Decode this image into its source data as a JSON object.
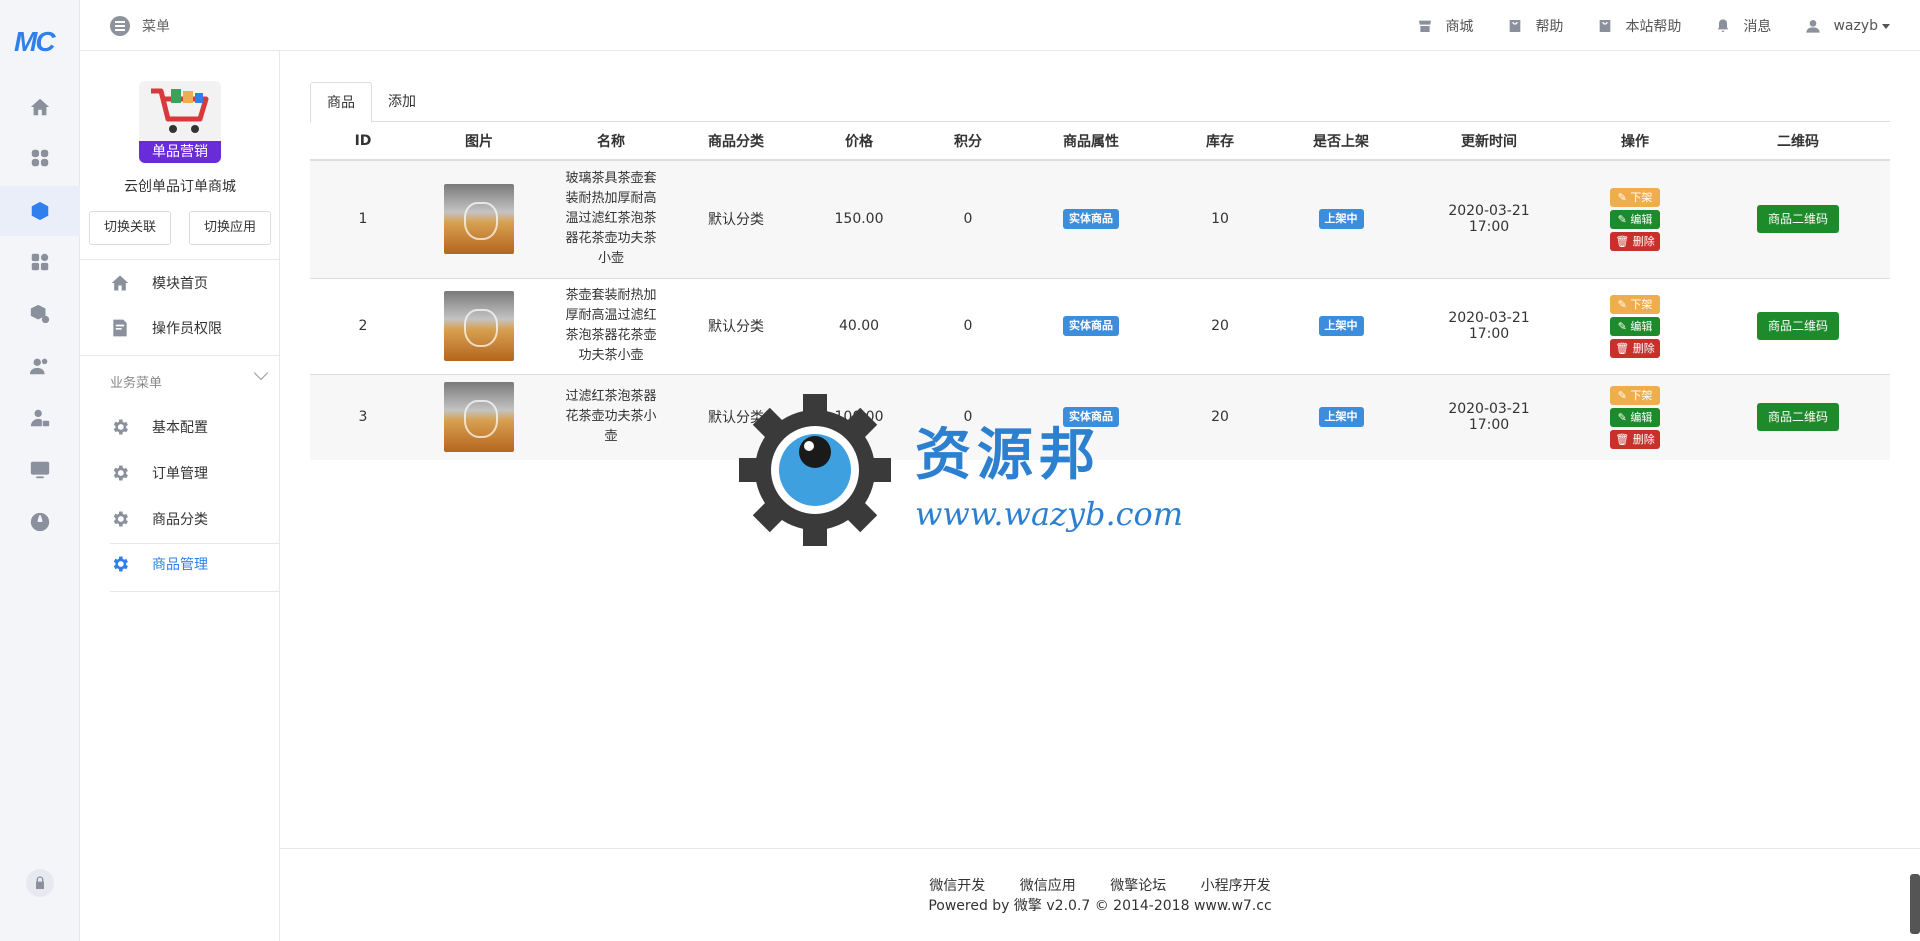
{
  "brand": {
    "logo_text": "MC"
  },
  "topbar": {
    "menu_label": "菜单",
    "nav": [
      {
        "label": "商城",
        "icon": "shop-icon"
      },
      {
        "label": "帮助",
        "icon": "help-bag-icon"
      },
      {
        "label": "本站帮助",
        "icon": "site-help-icon"
      },
      {
        "label": "消息",
        "icon": "bell-icon"
      }
    ],
    "user": "wazyb"
  },
  "app": {
    "logo_banner": "单品营销",
    "name": "云创单品订单商城",
    "switch_relation": "切换关联",
    "switch_app": "切换应用"
  },
  "sidebar": {
    "top_items": [
      {
        "label": "模块首页",
        "icon": "home-icon"
      },
      {
        "label": "操作员权限",
        "icon": "permission-icon"
      }
    ],
    "group_title": "业务菜单",
    "group_items": [
      {
        "label": "基本配置",
        "icon": "gear-icon"
      },
      {
        "label": "订单管理",
        "icon": "gear-icon"
      },
      {
        "label": "商品分类",
        "icon": "gear-icon"
      },
      {
        "label": "商品管理",
        "icon": "gear-icon",
        "active": true
      }
    ]
  },
  "tabs": [
    {
      "label": "商品",
      "active": true
    },
    {
      "label": "添加",
      "active": false
    }
  ],
  "table": {
    "columns": [
      "ID",
      "图片",
      "名称",
      "商品分类",
      "价格",
      "积分",
      "商品属性",
      "库存",
      "是否上架",
      "更新时间",
      "操作",
      "二维码"
    ],
    "rows": [
      {
        "id": "1",
        "name": "玻璃茶具茶壶套装耐热加厚耐高温过滤红茶泡茶器花茶壶功夫茶小壶",
        "category": "默认分类",
        "price": "150.00",
        "points": "0",
        "attr": "实体商品",
        "stock": "10",
        "status": "上架中",
        "updated_date": "2020-03-21",
        "updated_time": "17:00",
        "op_off": "下架",
        "op_edit": "编辑",
        "op_del": "删除",
        "qr": "商品二维码"
      },
      {
        "id": "2",
        "name": "茶壶套装耐热加厚耐高温过滤红茶泡茶器花茶壶功夫茶小壶",
        "category": "默认分类",
        "price": "40.00",
        "points": "0",
        "attr": "实体商品",
        "stock": "20",
        "status": "上架中",
        "updated_date": "2020-03-21",
        "updated_time": "17:00",
        "op_off": "下架",
        "op_edit": "编辑",
        "op_del": "删除",
        "qr": "商品二维码"
      },
      {
        "id": "3",
        "name": "过滤红茶泡茶器花茶壶功夫茶小壶",
        "category": "默认分类",
        "price": "100.00",
        "points": "0",
        "attr": "实体商品",
        "stock": "20",
        "status": "上架中",
        "updated_date": "2020-03-21",
        "updated_time": "17:00",
        "op_off": "下架",
        "op_edit": "编辑",
        "op_del": "删除",
        "qr": "商品二维码"
      }
    ]
  },
  "watermark": {
    "title": "资源邦",
    "url": "www.wazyb.com"
  },
  "footer": {
    "links": [
      "微信开发",
      "微信应用",
      "微擎论坛",
      "小程序开发"
    ],
    "copyright": "Powered by 微擎 v2.0.7 © 2014-2018 www.w7.cc"
  },
  "colors": {
    "accent": "#2f80ed",
    "success": "#1d8a2b",
    "warning": "#f0ad4e",
    "danger": "#c9302c",
    "label": "#3c8ddc"
  }
}
